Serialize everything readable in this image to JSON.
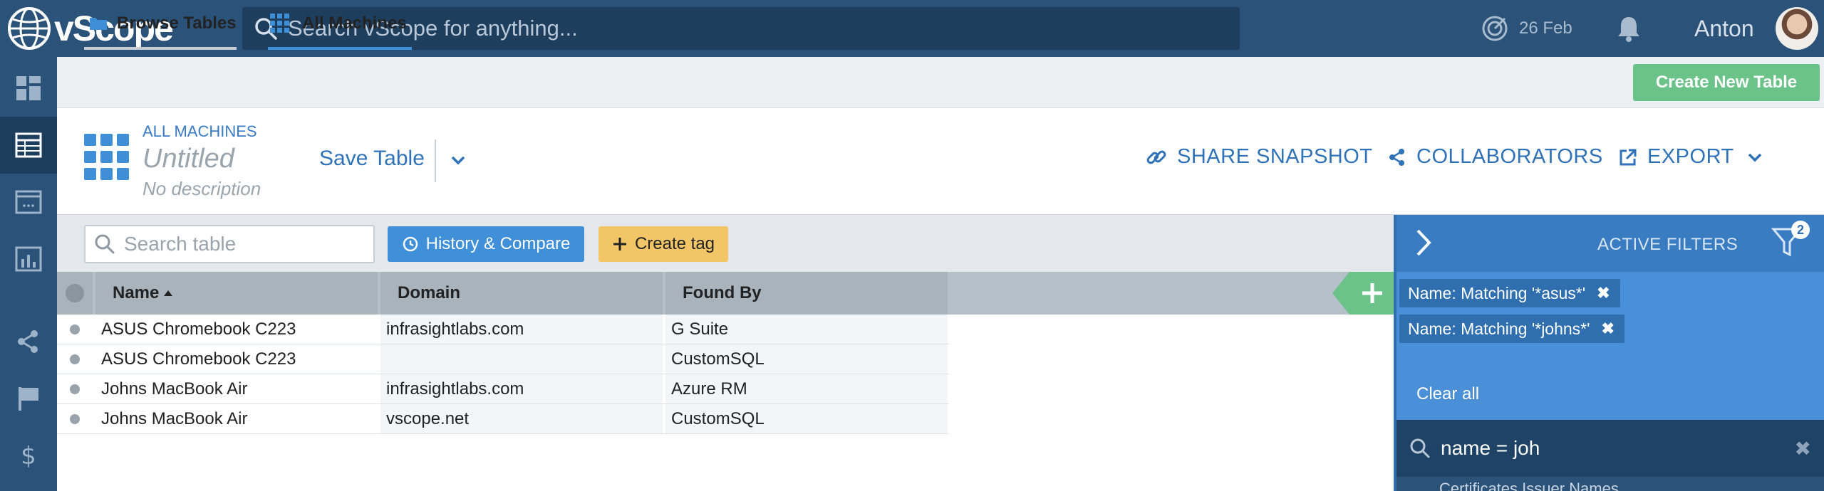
{
  "app": {
    "brand": "vScope"
  },
  "search": {
    "placeholder": "Search vScope for anything..."
  },
  "header": {
    "date": "26 Feb",
    "user": "Anton"
  },
  "tabs": [
    {
      "label": "Browse Tables"
    },
    {
      "label": "All Machines"
    }
  ],
  "create_table_label": "Create New Table",
  "table_header": {
    "breadcrumb": "ALL MACHINES",
    "title": "Untitled",
    "description": "No description",
    "save_label": "Save Table",
    "share_label": "SHARE SNAPSHOT",
    "collaborators_label": "COLLABORATORS",
    "export_label": "EXPORT"
  },
  "toolbar": {
    "search_placeholder": "Search table",
    "history_label": "History & Compare",
    "tag_label": "Create tag"
  },
  "columns": [
    "Name",
    "Domain",
    "Found By"
  ],
  "rows": [
    {
      "name": "ASUS Chromebook C223",
      "domain": "infrasightlabs.com",
      "found_by": "G Suite"
    },
    {
      "name": "ASUS Chromebook C223",
      "domain": "",
      "found_by": "CustomSQL"
    },
    {
      "name": "Johns MacBook Air",
      "domain": "infrasightlabs.com",
      "found_by": "Azure RM"
    },
    {
      "name": "Johns MacBook Air",
      "domain": "vscope.net",
      "found_by": "CustomSQL"
    }
  ],
  "filters": {
    "title": "ACTIVE FILTERS",
    "count": "2",
    "chips": [
      {
        "label": "Name: Matching '*asus*'"
      },
      {
        "label": "Name: Matching '*johns*'"
      }
    ],
    "clear_label": "Clear all",
    "search_value": "name = joh",
    "next_item": "Certificates Issuer Names"
  },
  "colors": {
    "topbar": "#2b5278",
    "accent_blue": "#3f8fd9",
    "create_green": "#6cc38a",
    "tag_yellow": "#f2c566",
    "filters_panel": "#4a90d9"
  }
}
